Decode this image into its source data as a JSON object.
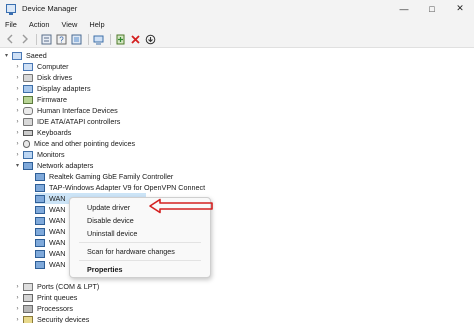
{
  "window": {
    "title": "Device Manager"
  },
  "menu": [
    "File",
    "Action",
    "View",
    "Help"
  ],
  "toolbar_icons": [
    "back-icon",
    "forward-icon",
    "properties-icon",
    "help-icon",
    "show-hidden-icon",
    "scan-icon",
    "monitor-icon",
    "add-driver-icon",
    "uninstall-icon",
    "download-icon"
  ],
  "tree": {
    "root": "Saeed",
    "categories": [
      "Computer",
      "Disk drives",
      "Display adapters",
      "Firmware",
      "Human Interface Devices",
      "IDE ATA/ATAPI controllers",
      "Keyboards",
      "Mice and other pointing devices",
      "Monitors",
      "Network adapters"
    ],
    "network_children": [
      "Realtek Gaming GbE Family Controller",
      "TAP-Windows Adapter V9 for OpenVPN Connect",
      "WAN",
      "WAN",
      "WAN",
      "WAN",
      "WAN",
      "WAN",
      "WAN"
    ],
    "after_categories": [
      "Ports (COM & LPT)",
      "Print queues",
      "Processors",
      "Security devices"
    ]
  },
  "context_menu": {
    "items": [
      "Update driver",
      "Disable device",
      "Uninstall device",
      "Scan for hardware changes",
      "Properties"
    ]
  },
  "colors": {
    "annotation_arrow": "#d42020",
    "selection": "#cce4f7"
  }
}
